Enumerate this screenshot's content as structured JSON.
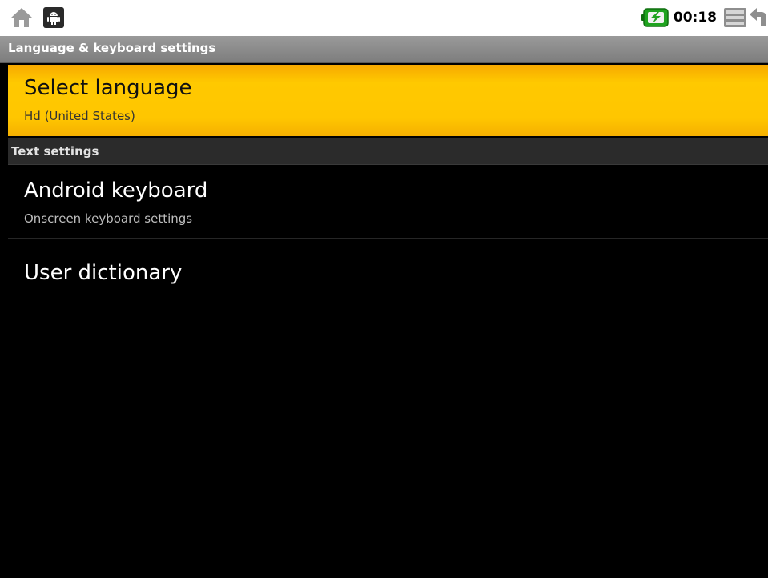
{
  "status_bar": {
    "left_icons": [
      "home-icon",
      "android-notification-icon"
    ],
    "battery_icon": "battery-charging-icon",
    "clock": "00:18",
    "right_icons": [
      "menu-icon",
      "back-icon"
    ],
    "battery_color": "#1fa31f"
  },
  "title_bar": {
    "title": "Language & keyboard settings"
  },
  "preferences": {
    "select_language": {
      "title": "Select language",
      "summary": "Hd (United States)"
    },
    "category_text": {
      "title": "Text settings"
    },
    "android_keyboard": {
      "title": "Android keyboard",
      "summary": "Onscreen keyboard settings"
    },
    "user_dictionary": {
      "title": "User dictionary"
    }
  },
  "colors": {
    "selected_highlight": "#ffc600",
    "background": "#000000"
  }
}
